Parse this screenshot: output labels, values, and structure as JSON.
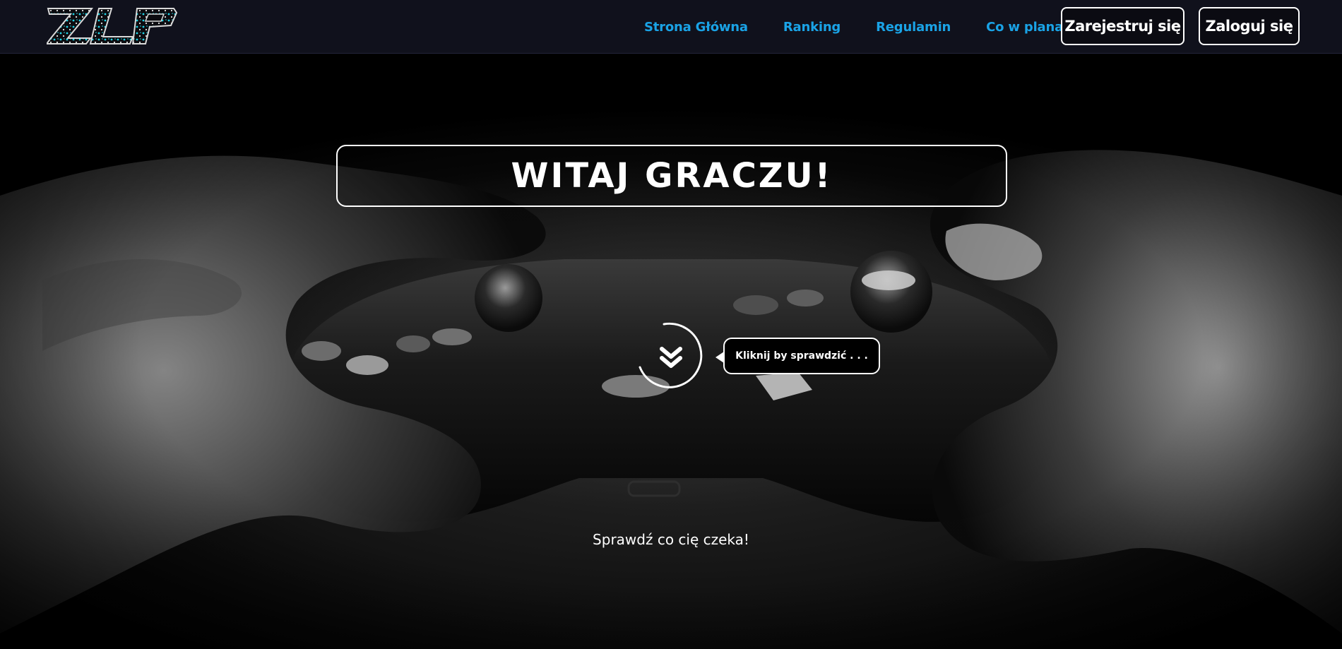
{
  "navbar": {
    "logo_text": "ZLP",
    "links": [
      {
        "label": "Strona Główna"
      },
      {
        "label": "Ranking"
      },
      {
        "label": "Regulamin"
      },
      {
        "label": "Co w planach"
      }
    ],
    "register_label": "Zarejestruj się",
    "login_label": "Zaloguj się"
  },
  "hero": {
    "title": "WITAJ GRACZU!",
    "scroll_icon": "chevron-double-down-icon",
    "tooltip": "Kliknij by sprawdzić . . .",
    "subtitle": "Sprawdź co cię czeka!"
  },
  "colors": {
    "navbar_bg": "#10111c",
    "link": "#1aa3e6",
    "button_border": "#ffffff",
    "logo_accent": "#22d3e6"
  }
}
